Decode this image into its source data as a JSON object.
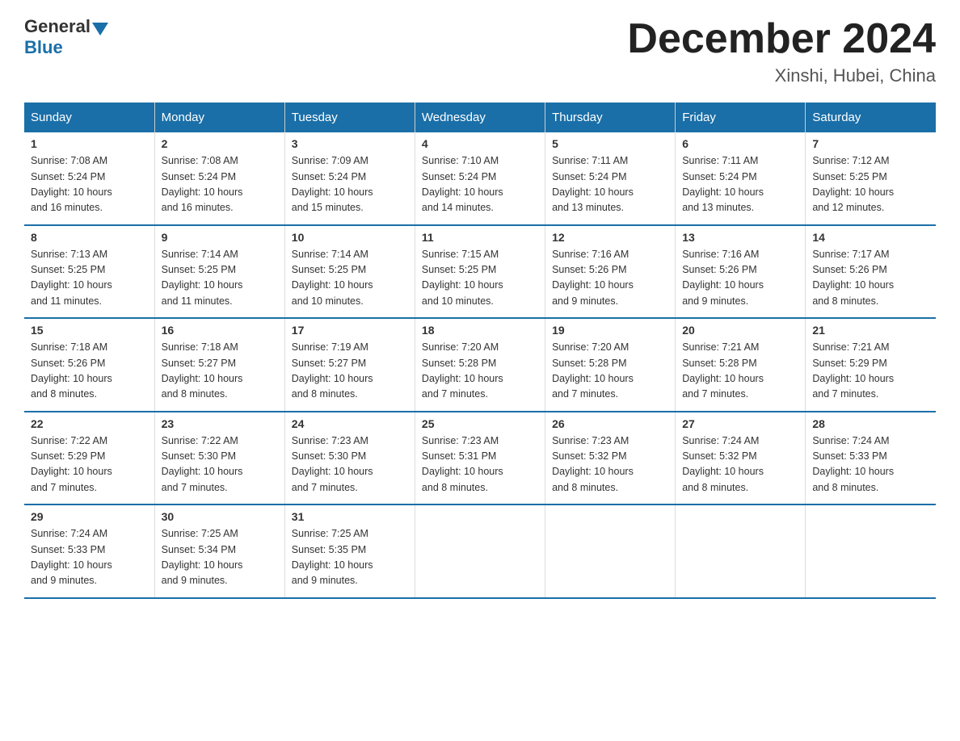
{
  "header": {
    "logo_general": "General",
    "logo_blue": "Blue",
    "title": "December 2024",
    "subtitle": "Xinshi, Hubei, China"
  },
  "weekdays": [
    "Sunday",
    "Monday",
    "Tuesday",
    "Wednesday",
    "Thursday",
    "Friday",
    "Saturday"
  ],
  "weeks": [
    [
      {
        "day": "1",
        "sunrise": "7:08 AM",
        "sunset": "5:24 PM",
        "daylight": "10 hours and 16 minutes."
      },
      {
        "day": "2",
        "sunrise": "7:08 AM",
        "sunset": "5:24 PM",
        "daylight": "10 hours and 16 minutes."
      },
      {
        "day": "3",
        "sunrise": "7:09 AM",
        "sunset": "5:24 PM",
        "daylight": "10 hours and 15 minutes."
      },
      {
        "day": "4",
        "sunrise": "7:10 AM",
        "sunset": "5:24 PM",
        "daylight": "10 hours and 14 minutes."
      },
      {
        "day": "5",
        "sunrise": "7:11 AM",
        "sunset": "5:24 PM",
        "daylight": "10 hours and 13 minutes."
      },
      {
        "day": "6",
        "sunrise": "7:11 AM",
        "sunset": "5:24 PM",
        "daylight": "10 hours and 13 minutes."
      },
      {
        "day": "7",
        "sunrise": "7:12 AM",
        "sunset": "5:25 PM",
        "daylight": "10 hours and 12 minutes."
      }
    ],
    [
      {
        "day": "8",
        "sunrise": "7:13 AM",
        "sunset": "5:25 PM",
        "daylight": "10 hours and 11 minutes."
      },
      {
        "day": "9",
        "sunrise": "7:14 AM",
        "sunset": "5:25 PM",
        "daylight": "10 hours and 11 minutes."
      },
      {
        "day": "10",
        "sunrise": "7:14 AM",
        "sunset": "5:25 PM",
        "daylight": "10 hours and 10 minutes."
      },
      {
        "day": "11",
        "sunrise": "7:15 AM",
        "sunset": "5:25 PM",
        "daylight": "10 hours and 10 minutes."
      },
      {
        "day": "12",
        "sunrise": "7:16 AM",
        "sunset": "5:26 PM",
        "daylight": "10 hours and 9 minutes."
      },
      {
        "day": "13",
        "sunrise": "7:16 AM",
        "sunset": "5:26 PM",
        "daylight": "10 hours and 9 minutes."
      },
      {
        "day": "14",
        "sunrise": "7:17 AM",
        "sunset": "5:26 PM",
        "daylight": "10 hours and 8 minutes."
      }
    ],
    [
      {
        "day": "15",
        "sunrise": "7:18 AM",
        "sunset": "5:26 PM",
        "daylight": "10 hours and 8 minutes."
      },
      {
        "day": "16",
        "sunrise": "7:18 AM",
        "sunset": "5:27 PM",
        "daylight": "10 hours and 8 minutes."
      },
      {
        "day": "17",
        "sunrise": "7:19 AM",
        "sunset": "5:27 PM",
        "daylight": "10 hours and 8 minutes."
      },
      {
        "day": "18",
        "sunrise": "7:20 AM",
        "sunset": "5:28 PM",
        "daylight": "10 hours and 7 minutes."
      },
      {
        "day": "19",
        "sunrise": "7:20 AM",
        "sunset": "5:28 PM",
        "daylight": "10 hours and 7 minutes."
      },
      {
        "day": "20",
        "sunrise": "7:21 AM",
        "sunset": "5:28 PM",
        "daylight": "10 hours and 7 minutes."
      },
      {
        "day": "21",
        "sunrise": "7:21 AM",
        "sunset": "5:29 PM",
        "daylight": "10 hours and 7 minutes."
      }
    ],
    [
      {
        "day": "22",
        "sunrise": "7:22 AM",
        "sunset": "5:29 PM",
        "daylight": "10 hours and 7 minutes."
      },
      {
        "day": "23",
        "sunrise": "7:22 AM",
        "sunset": "5:30 PM",
        "daylight": "10 hours and 7 minutes."
      },
      {
        "day": "24",
        "sunrise": "7:23 AM",
        "sunset": "5:30 PM",
        "daylight": "10 hours and 7 minutes."
      },
      {
        "day": "25",
        "sunrise": "7:23 AM",
        "sunset": "5:31 PM",
        "daylight": "10 hours and 8 minutes."
      },
      {
        "day": "26",
        "sunrise": "7:23 AM",
        "sunset": "5:32 PM",
        "daylight": "10 hours and 8 minutes."
      },
      {
        "day": "27",
        "sunrise": "7:24 AM",
        "sunset": "5:32 PM",
        "daylight": "10 hours and 8 minutes."
      },
      {
        "day": "28",
        "sunrise": "7:24 AM",
        "sunset": "5:33 PM",
        "daylight": "10 hours and 8 minutes."
      }
    ],
    [
      {
        "day": "29",
        "sunrise": "7:24 AM",
        "sunset": "5:33 PM",
        "daylight": "10 hours and 9 minutes."
      },
      {
        "day": "30",
        "sunrise": "7:25 AM",
        "sunset": "5:34 PM",
        "daylight": "10 hours and 9 minutes."
      },
      {
        "day": "31",
        "sunrise": "7:25 AM",
        "sunset": "5:35 PM",
        "daylight": "10 hours and 9 minutes."
      },
      null,
      null,
      null,
      null
    ]
  ],
  "labels": {
    "sunrise": "Sunrise:",
    "sunset": "Sunset:",
    "daylight": "Daylight:"
  }
}
